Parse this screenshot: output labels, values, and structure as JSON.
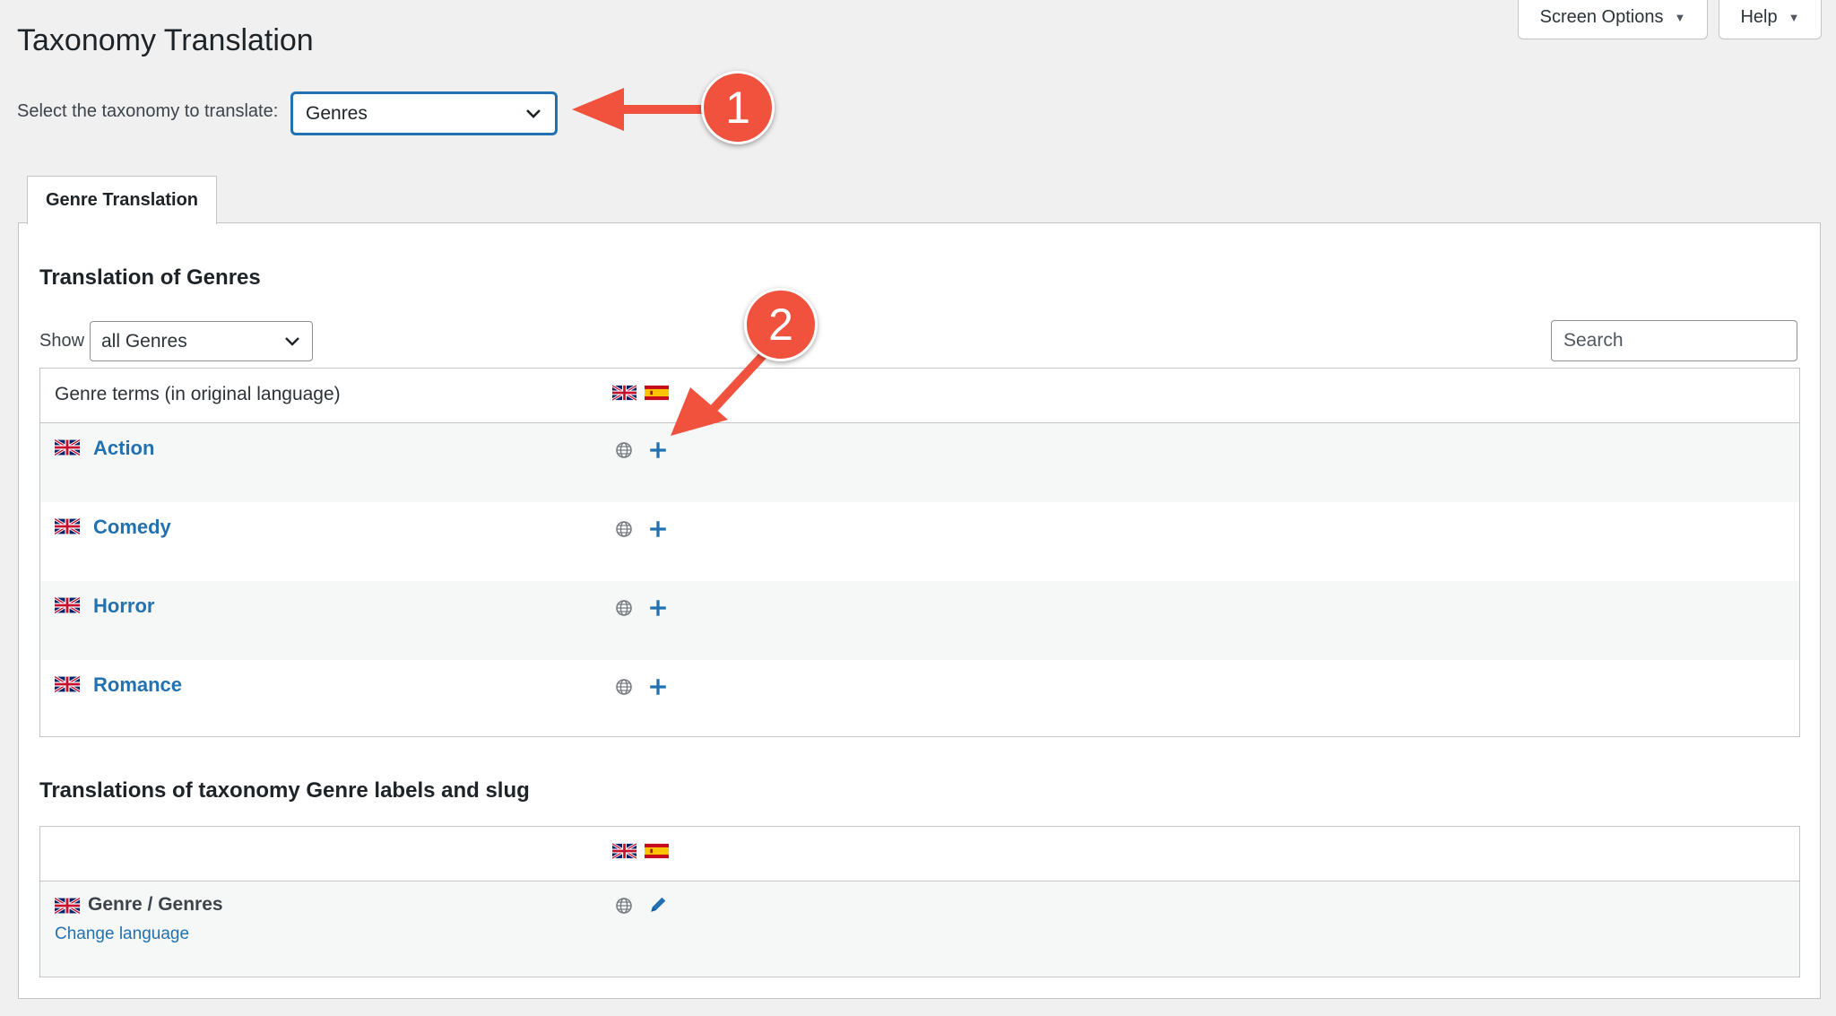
{
  "header": {
    "screen_options_label": "Screen Options",
    "help_label": "Help",
    "title": "Taxonomy Translation"
  },
  "taxonomy_selector": {
    "label": "Select the taxonomy to translate:",
    "selected": "Genres"
  },
  "tabs": [
    {
      "label": "Genre Translation"
    }
  ],
  "terms_section": {
    "heading": "Translation of Genres",
    "show_label": "Show",
    "show_selected": "all Genres",
    "search_placeholder": "Search",
    "column_header": "Genre terms (in original language)",
    "terms": [
      {
        "name": "Action"
      },
      {
        "name": "Comedy"
      },
      {
        "name": "Horror"
      },
      {
        "name": "Romance"
      }
    ]
  },
  "labels_section": {
    "heading": "Translations of taxonomy Genre labels and slug",
    "label_name": "Genre / Genres",
    "change_language": "Change language"
  },
  "annotations": {
    "marker_1": "1",
    "marker_2": "2"
  },
  "icons": {
    "flag_original": "uk-flag-icon",
    "flag_translation": "spain-flag-icon",
    "globe": "globe-icon",
    "add": "plus-icon",
    "edit": "pencil-icon"
  },
  "colors": {
    "accent": "#2271b1",
    "annotation": "#f0523e",
    "background": "#f0f0f1"
  }
}
